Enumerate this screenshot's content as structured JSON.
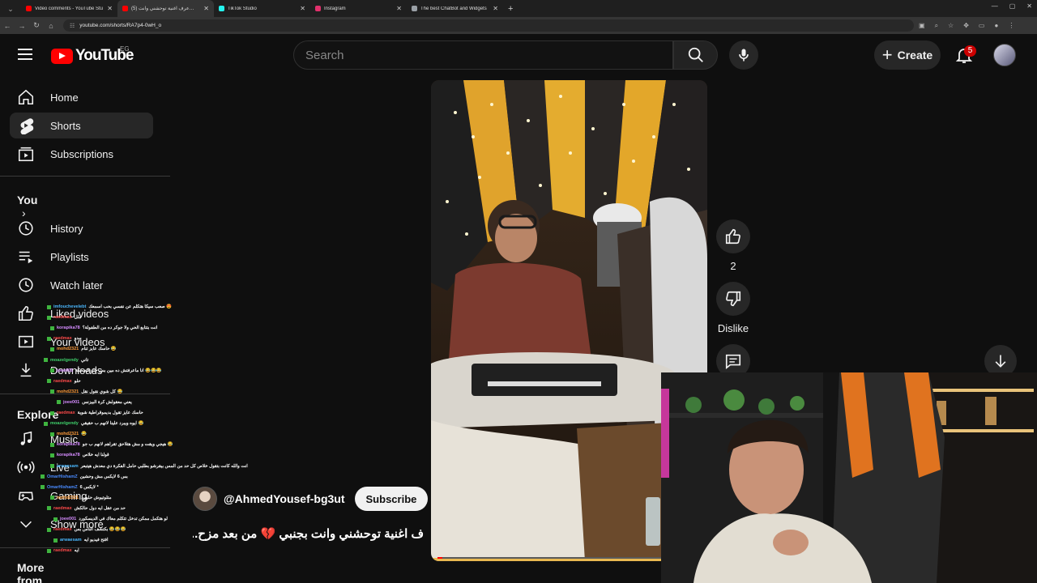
{
  "browser": {
    "tabs": [
      {
        "title": "Video comments - YouTube Stu",
        "favicon_color": "#ff0000",
        "active": false
      },
      {
        "title": "(5) عرف اغنية توحشني وانت…",
        "favicon_color": "#ff0000",
        "active": true
      },
      {
        "title": "TikTok Studio",
        "favicon_color": "#25f4ee",
        "active": false
      },
      {
        "title": "Instagram",
        "favicon_color": "#e1306c",
        "active": false
      },
      {
        "title": "The best ChatBot and Widgets",
        "favicon_color": "#9aa0a6",
        "active": false
      }
    ],
    "url": "youtube.com/shorts/RA7p4-0wH_o"
  },
  "header": {
    "logo_text": "YouTube",
    "country_code": "EG",
    "search_placeholder": "Search",
    "create_label": "Create",
    "notification_count": "5"
  },
  "sidebar": {
    "primary": [
      {
        "label": "Home",
        "icon": "home-icon"
      },
      {
        "label": "Shorts",
        "icon": "shorts-icon",
        "active": true
      },
      {
        "label": "Subscriptions",
        "icon": "subscriptions-icon"
      }
    ],
    "you_heading": "You",
    "you_items": [
      {
        "label": "History",
        "icon": "history-icon"
      },
      {
        "label": "Playlists",
        "icon": "playlists-icon"
      },
      {
        "label": "Watch later",
        "icon": "watch-later-icon"
      },
      {
        "label": "Liked videos",
        "icon": "like-icon"
      },
      {
        "label": "Your videos",
        "icon": "your-videos-icon"
      },
      {
        "label": "Downloads",
        "icon": "downloads-icon"
      }
    ],
    "explore_heading": "Explore",
    "explore_items": [
      {
        "label": "Music",
        "icon": "music-icon"
      },
      {
        "label": "Live",
        "icon": "live-icon"
      },
      {
        "label": "Gaming",
        "icon": "gaming-icon"
      },
      {
        "label": "Show more",
        "icon": "chevron-down-icon"
      }
    ],
    "more_heading": "More from YouTube"
  },
  "chat_overlay": [
    {
      "user": "imfouchevelebt",
      "user_color": "#4ab8ff",
      "text": "صعب سيكا هتكلم عن نفسي بحب اسمعك 😍"
    },
    {
      "user": "raedmax",
      "user_color": "#ff4a4a",
      "text": "مثل"
    },
    {
      "user": "korapika78",
      "user_color": "#d58cff",
      "text": "انت بتتابع الحي ولا جوكر ده من الطفولة؟"
    },
    {
      "user": "raedmax",
      "user_color": "#ff4a4a",
      "text": "يبدو"
    },
    {
      "user": "mohd2321",
      "user_color": "#ff9c3a",
      "text": "حاسك عايز تنام 😂"
    },
    {
      "user": "moazelgendy",
      "user_color": "#3fd16b",
      "text": "تاني"
    },
    {
      "user": "joee001",
      "user_color": "#d58cff",
      "text": "انا ماعرفتش ده مين بس حلو الضحكة 😂😂😂"
    },
    {
      "user": "raedmax",
      "user_color": "#ff4a4a",
      "text": "حلو"
    },
    {
      "user": "mohd2321",
      "user_color": "#ff9c3a",
      "text": "كل شوي نقول نقل 😂"
    },
    {
      "user": "joee001",
      "user_color": "#d58cff",
      "text": "يعني معقولش كرة البيزنس"
    },
    {
      "user": "raedmax",
      "user_color": "#ff4a4a",
      "text": "حاسك عايز تقول بديموقراطية شوية"
    },
    {
      "user": "moazelgendy",
      "user_color": "#3fd16b",
      "text": "ايوه ويبرد علينا لانهم ب حقيقي 😂"
    },
    {
      "user": "mohd2321",
      "user_color": "#ff9c3a",
      "text": "😂"
    },
    {
      "user": "korapika78",
      "user_color": "#d58cff",
      "text": "هيجي ويقت و مش هتلاحق تقراهم لانهم ب جو 😂"
    },
    {
      "user": "korapika78",
      "user_color": "#d58cff",
      "text": "قولنا ايه خلاص"
    },
    {
      "user": "arwaesam",
      "user_color": "#4ab8ff",
      "text": "انت والله كانت بتقول خلاص كل حد من المس بيقرشو بطلبي حامل الفكرة دي معدش هيتبعر"
    },
    {
      "user": "OmarHishamZ",
      "user_color": "#4a8bff",
      "text": "بس 6 لايكس مش وحشين"
    },
    {
      "user": "OmarHishamZ",
      "user_color": "#4a8bff",
      "text": "6 لايكس *"
    },
    {
      "user": "mohd2321",
      "user_color": "#ff9c3a",
      "text": "متلوتيوش حلوين"
    },
    {
      "user": "raedmax",
      "user_color": "#ff4a4a",
      "text": "حد من عقل ايه دول حالكش"
    },
    {
      "user": "joee001",
      "user_color": "#d58cff",
      "text": "لو هتكمل ممكن تدخل تتكلم معاك في الديسكورد"
    },
    {
      "user": "raedmax",
      "user_color": "#ff4a4a",
      "text": "بكتشف الناس بس 😂😂😂"
    },
    {
      "user": "arwaesam",
      "user_color": "#4ab8ff",
      "text": "افتح فيديو ايه"
    },
    {
      "user": "raedmax",
      "user_color": "#ff4a4a",
      "text": "ايه"
    }
  ],
  "short": {
    "channel_name": "@AhmedYousef-bg3ut",
    "subscribe_label": "Subscribe",
    "title": "ف اغنية توحشني وانت بجنبي 💔 من بعد مزح...",
    "like_count": "2",
    "dislike_label": "Dislike",
    "progress_fraction": 0.02
  }
}
